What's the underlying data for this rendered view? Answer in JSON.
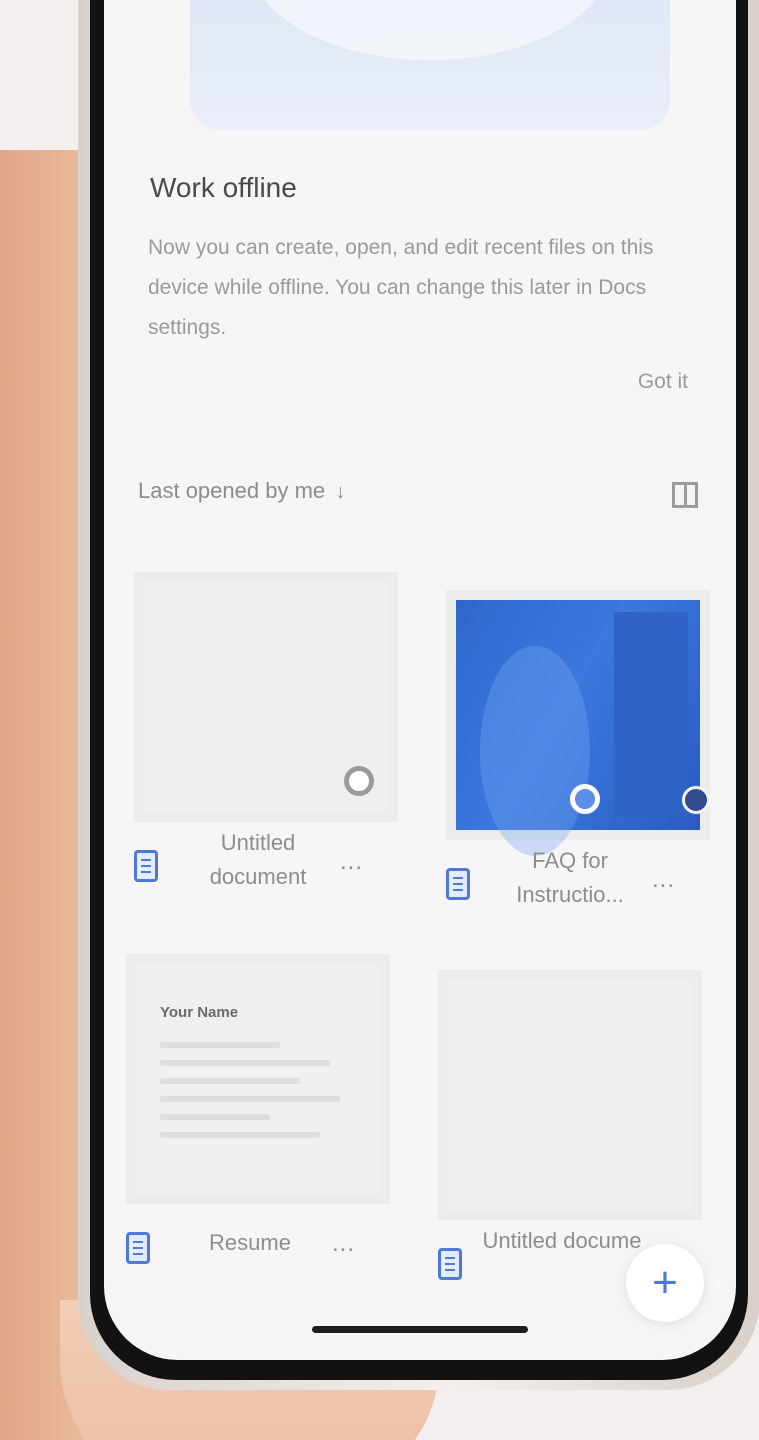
{
  "banner": {
    "title": "Work offline",
    "body": "Now you can create, open, and edit recent files on this device while offline. You can change this later in Docs settings.",
    "dismiss_label": "Got it"
  },
  "list": {
    "sort_label": "Last opened by me",
    "sort_icon": "arrow-down-icon",
    "view_icon": "grid-view-icon"
  },
  "files": [
    {
      "title": "Untitled document",
      "icon": "docs-icon",
      "menu_label": "...",
      "thumbnail": "blank"
    },
    {
      "title": "FAQ for Instructio...",
      "icon": "docs-icon",
      "menu_label": "...",
      "thumbnail": "blue-cover"
    },
    {
      "title": "Resume",
      "icon": "docs-icon",
      "menu_label": "...",
      "thumbnail": "resume",
      "preview_title": "Your Name"
    },
    {
      "title": "Untitled docume",
      "icon": "docs-icon",
      "menu_label": "...",
      "thumbnail": "blank"
    }
  ],
  "fab": {
    "label": "+"
  },
  "colors": {
    "accent": "#4b78d9",
    "doc_icon": "#4e79d8",
    "text_primary": "#4a4a4a",
    "text_secondary": "#9a9a9a",
    "screen_bg": "#f7f5f6"
  }
}
